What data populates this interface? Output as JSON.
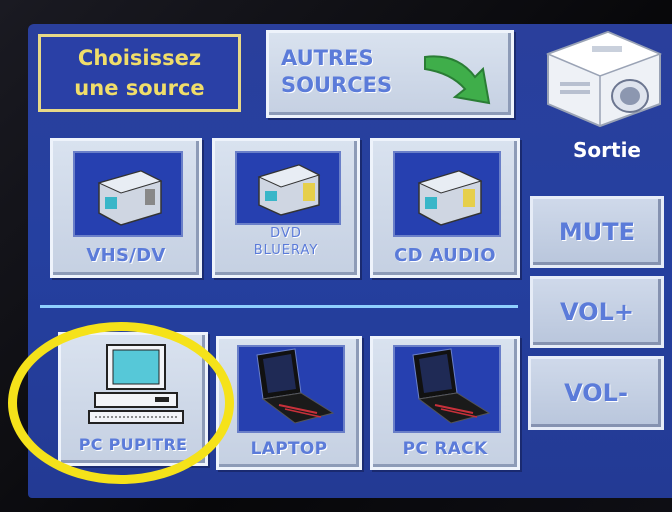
{
  "header": {
    "title_line1": "Choisissez",
    "title_line2": "une source",
    "other_sources_line1": "AUTRES",
    "other_sources_line2": "SOURCES"
  },
  "output": {
    "label": "Sortie"
  },
  "sources_row1": [
    {
      "label": "VHS/DV"
    },
    {
      "label_line1": "DVD",
      "label_line2": "BLUERAY"
    },
    {
      "label": "CD AUDIO"
    }
  ],
  "sources_row2": [
    {
      "label": "PC PUPITRE"
    },
    {
      "label": "LAPTOP"
    },
    {
      "label": "PC RACK"
    }
  ],
  "audio_controls": {
    "mute": "MUTE",
    "vol_up": "VOL+",
    "vol_down": "VOL-"
  },
  "colors": {
    "screen_bg": "#2540a0",
    "label_text": "#5b7bd9",
    "title_text": "#f0dd6a",
    "highlight_circle": "#f5e21a",
    "arrow": "#3fae4a"
  },
  "icons": {
    "deck": "cassette-deck-icon",
    "desktop": "desktop-computer-icon",
    "laptop": "laptop-icon",
    "projector": "projector-icon",
    "arrow": "green-arrow-icon"
  }
}
